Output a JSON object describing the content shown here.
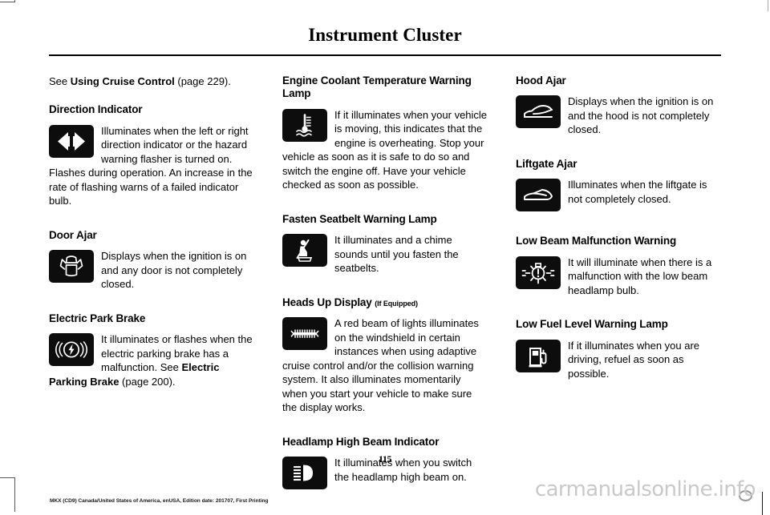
{
  "document": {
    "title": "Instrument Cluster",
    "page_number": "115",
    "footer_note": "MKX (CD9) Canada/United States of America, enUSA, Edition date: 201707, First Printing",
    "watermark": "carmanualsonline.info"
  },
  "columns": [
    {
      "intro": {
        "prefix": "See ",
        "bold": "Using Cruise Control",
        "suffix": " (page 229)."
      },
      "sections": [
        {
          "heading": "Direction Indicator",
          "icon": "direction-indicator-icon",
          "body_prefix": "Illuminates when the left or right direction indicator or the hazard warning flasher is turned on.  Flashes during operation.  An increase in the rate of flashing warns of a failed indicator bulb.",
          "body_bold": "",
          "body_suffix": ""
        },
        {
          "heading": "Door Ajar",
          "icon": "door-ajar-icon",
          "body_prefix": "Displays when the ignition is on and any door is not completely closed.",
          "body_bold": "",
          "body_suffix": ""
        },
        {
          "heading": "Electric Park Brake",
          "icon": "electric-park-brake-icon",
          "body_prefix": "It illuminates or flashes when the electric parking brake has a malfunction. See ",
          "body_bold": "Electric Parking Brake",
          "body_suffix": " (page 200)."
        }
      ]
    },
    {
      "intro": null,
      "sections": [
        {
          "heading": "Engine Coolant Temperature Warning Lamp",
          "icon": "engine-coolant-temperature-icon",
          "body_prefix": "If it illuminates when your vehicle is moving, this indicates that the engine is overheating.  Stop your vehicle as soon as it is safe to do so and switch the engine off.  Have your vehicle checked as soon as possible.",
          "body_bold": "",
          "body_suffix": ""
        },
        {
          "heading": "Fasten Seatbelt Warning Lamp",
          "icon": "fasten-seatbelt-icon",
          "body_prefix": "It illuminates and a chime sounds until you fasten the seatbelts.",
          "body_bold": "",
          "body_suffix": ""
        },
        {
          "heading": "Heads Up Display",
          "heading_suffix": "(If Equipped)",
          "icon": "heads-up-display-icon",
          "body_prefix": "A red beam of lights illuminates on the windshield in certain instances when using adaptive cruise control and/or the collision warning system. It also illuminates momentarily when you start your vehicle to make sure the display works.",
          "body_bold": "",
          "body_suffix": ""
        },
        {
          "heading": "Headlamp High Beam Indicator",
          "icon": "headlamp-high-beam-icon",
          "body_prefix": "It illuminates when you switch the headlamp high beam on.",
          "body_bold": "",
          "body_suffix": ""
        }
      ]
    },
    {
      "intro": null,
      "sections": [
        {
          "heading": "Hood Ajar",
          "icon": "hood-ajar-icon",
          "body_prefix": "Displays when the ignition is on and the hood is not completely closed.",
          "body_bold": "",
          "body_suffix": ""
        },
        {
          "heading": "Liftgate Ajar",
          "icon": "liftgate-ajar-icon",
          "body_prefix": "Illuminates when the liftgate is not completely closed.",
          "body_bold": "",
          "body_suffix": ""
        },
        {
          "heading": "Low Beam Malfunction Warning",
          "icon": "low-beam-malfunction-icon",
          "body_prefix": "It will illuminate when there is a malfunction with the low beam headlamp bulb.",
          "body_bold": "",
          "body_suffix": ""
        },
        {
          "heading": "Low Fuel Level Warning Lamp",
          "icon": "low-fuel-level-icon",
          "body_prefix": "If it illuminates when you are driving, refuel as soon as possible.",
          "body_bold": "",
          "body_suffix": ""
        }
      ]
    }
  ],
  "colors": {
    "icon_background": "#0d0d0d",
    "icon_foreground": "#ffffff",
    "text": "#000000",
    "watermark": "#c9c9c9"
  }
}
